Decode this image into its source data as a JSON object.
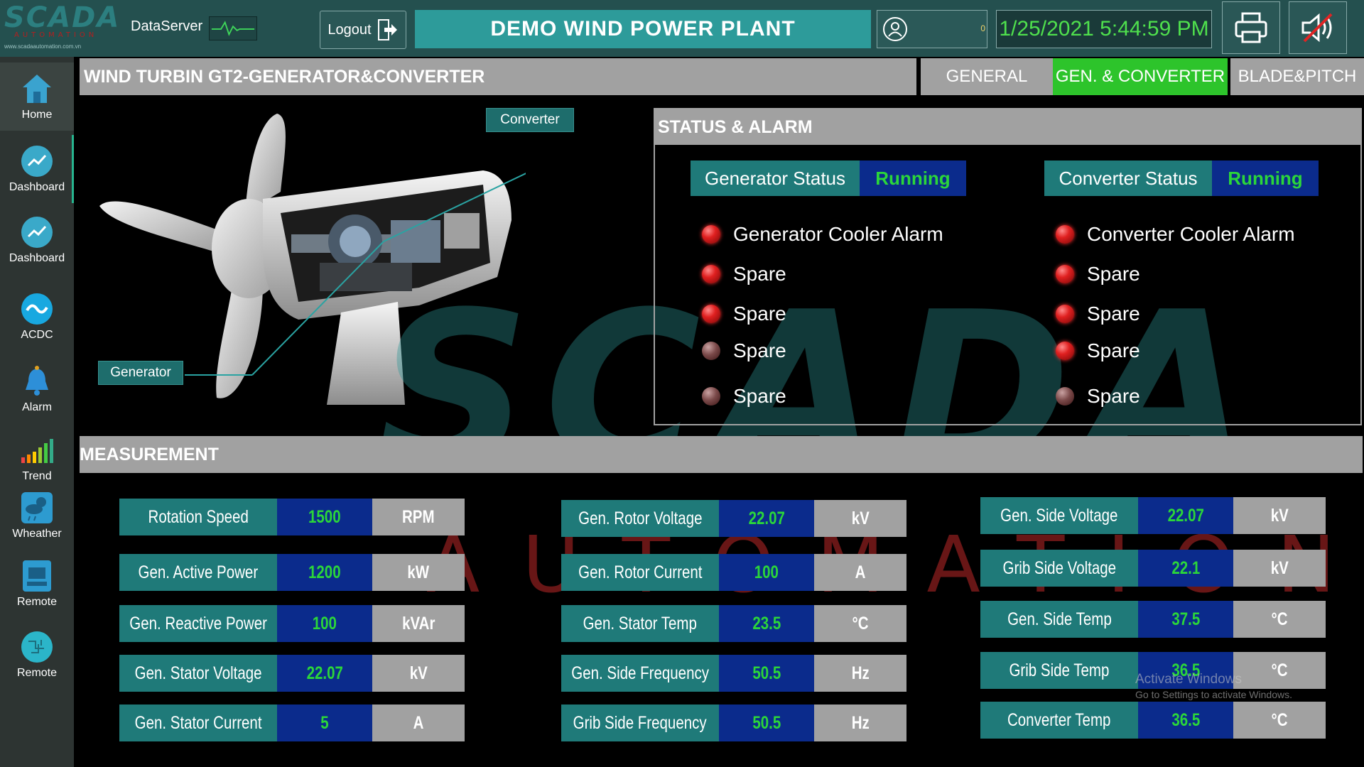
{
  "header": {
    "logo_text": "SCADA",
    "logo_sub": "AUTOMATION",
    "logo_url": "www.scadaautomation.com.vn",
    "dataserver_label": "DataServer",
    "logout_label": "Logout",
    "plant_title": "DEMO WIND POWER PLANT",
    "user_value": "0",
    "datetime": "1/25/2021 5:44:59 PM"
  },
  "sidebar": {
    "items": [
      {
        "label": "Home",
        "icon": "home-icon"
      },
      {
        "label": "Dashboard",
        "icon": "chart-icon"
      },
      {
        "label": "Dashboard",
        "icon": "chart-icon"
      },
      {
        "label": "ACDC",
        "icon": "ac-dc-icon"
      },
      {
        "label": "Alarm",
        "icon": "bell-icon"
      },
      {
        "label": "Trend",
        "icon": "bar-trend-icon"
      },
      {
        "label": "Wheather",
        "icon": "weather-icon"
      },
      {
        "label": "Remote",
        "icon": "remote-icon"
      },
      {
        "label": "Remote",
        "icon": "circuit-icon"
      }
    ]
  },
  "page": {
    "title": "WIND TURBIN GT2-GENERATOR&CONVERTER",
    "tabs": [
      {
        "label": "GENERAL",
        "active": false
      },
      {
        "label": "GEN. & CONVERTER",
        "active": true
      },
      {
        "label": "BLADE&PITCH",
        "active": false
      }
    ]
  },
  "turbine": {
    "converter_label": "Converter",
    "generator_label": "Generator"
  },
  "status": {
    "title": "STATUS & ALARM",
    "generator_status_label": "Generator Status",
    "generator_status_value": "Running",
    "converter_status_label": "Converter Status",
    "converter_status_value": "Running",
    "generator_alarms": [
      {
        "label": "Generator Cooler Alarm",
        "active": true
      },
      {
        "label": "Spare",
        "active": true
      },
      {
        "label": "Spare",
        "active": true
      },
      {
        "label": "Spare",
        "active": false
      },
      {
        "label": "Spare",
        "active": false
      }
    ],
    "converter_alarms": [
      {
        "label": "Converter Cooler Alarm",
        "active": true
      },
      {
        "label": "Spare",
        "active": true
      },
      {
        "label": "Spare",
        "active": true
      },
      {
        "label": "Spare",
        "active": true
      },
      {
        "label": "Spare",
        "active": false
      }
    ]
  },
  "measurement": {
    "title": "MEASUREMENT",
    "col1": [
      {
        "label": "Rotation Speed",
        "value": "1500",
        "unit": "RPM"
      },
      {
        "label": "Gen. Active Power",
        "value": "1200",
        "unit": "kW"
      },
      {
        "label": "Gen. Reactive Power",
        "value": "100",
        "unit": "kVAr"
      },
      {
        "label": "Gen. Stator Voltage",
        "value": "22.07",
        "unit": "kV"
      },
      {
        "label": "Gen. Stator Current",
        "value": "5",
        "unit": "A"
      }
    ],
    "col2": [
      {
        "label": "Gen. Rotor Voltage",
        "value": "22.07",
        "unit": "kV"
      },
      {
        "label": "Gen. Rotor Current",
        "value": "100",
        "unit": "A"
      },
      {
        "label": "Gen. Stator Temp",
        "value": "23.5",
        "unit": "°C"
      },
      {
        "label": "Gen. Side Frequency",
        "value": "50.5",
        "unit": "Hz"
      },
      {
        "label": "Grib Side Frequency",
        "value": "50.5",
        "unit": "Hz"
      }
    ],
    "col3": [
      {
        "label": "Gen. Side Voltage",
        "value": "22.07",
        "unit": "kV"
      },
      {
        "label": "Grib Side Voltage",
        "value": "22.1",
        "unit": "kV"
      },
      {
        "label": "Gen. Side Temp",
        "value": "37.5",
        "unit": "°C"
      },
      {
        "label": "Grib Side Temp",
        "value": "36.5",
        "unit": "°C"
      },
      {
        "label": "Converter Temp",
        "value": "36.5",
        "unit": "°C"
      }
    ]
  },
  "watermark": {
    "big": "SCADA",
    "small": "AUTOMATION"
  },
  "os_notice": {
    "line1": "Activate Windows",
    "line2": "Go to Settings to activate Windows."
  },
  "colors": {
    "header_bg": "#24504f",
    "accent_teal": "#1f7a79",
    "value_blue": "#0b2b8c",
    "value_green": "#2bd63a",
    "tab_active": "#2dc42b",
    "datetime_green": "#4fe04d",
    "panel_gray": "#a1a1a1"
  }
}
